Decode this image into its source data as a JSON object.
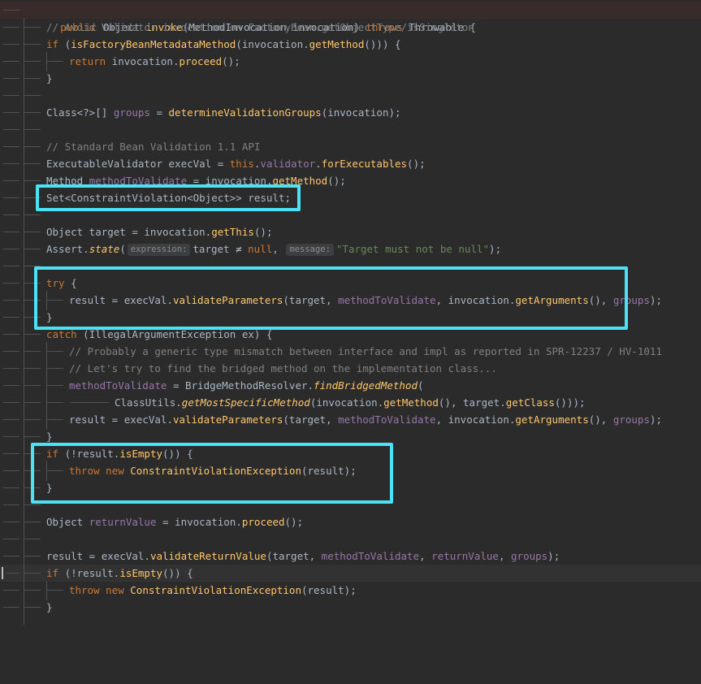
{
  "editor": {
    "lines": [
      {
        "text": "public Object invoke(MethodInvocation invocation) throws Throwable {"
      },
      {
        "text": "// Avoid Validator invocation on FactoryBean.getObjectType/isSingleton"
      },
      {
        "text": "if (isFactoryBeanMetadataMethod(invocation.getMethod())) {"
      },
      {
        "text": "return invocation.proceed();"
      },
      {
        "text": "}"
      },
      {
        "text": ""
      },
      {
        "text": "Class<?>[] groups = determineValidationGroups(invocation);"
      },
      {
        "text": ""
      },
      {
        "text": "// Standard Bean Validation 1.1 API"
      },
      {
        "text": "ExecutableValidator execVal = this.validator.forExecutables();"
      },
      {
        "text": "Method methodToValidate = invocation.getMethod();"
      },
      {
        "text": "Set<ConstraintViolation<Object>> result;"
      },
      {
        "text": ""
      },
      {
        "text": "Object target = invocation.getThis();"
      },
      {
        "text": "Assert.state( expression: target ≠ null,  message: \"Target must not be null\");"
      },
      {
        "text": ""
      },
      {
        "text": "try {"
      },
      {
        "text": "result = execVal.validateParameters(target, methodToValidate, invocation.getArguments(), groups);"
      },
      {
        "text": "}"
      },
      {
        "text": "catch (IllegalArgumentException ex) {"
      },
      {
        "text": "// Probably a generic type mismatch between interface and impl as reported in SPR-12237 / HV-1011"
      },
      {
        "text": "// Let's try to find the bridged method on the implementation class..."
      },
      {
        "text": "methodToValidate = BridgeMethodResolver.findBridgedMethod("
      },
      {
        "text": "ClassUtils.getMostSpecificMethod(invocation.getMethod(), target.getClass()));"
      },
      {
        "text": "result = execVal.validateParameters(target, methodToValidate, invocation.getArguments(), groups);"
      },
      {
        "text": "}"
      },
      {
        "text": "if (!result.isEmpty()) {"
      },
      {
        "text": "throw new ConstraintViolationException(result);"
      },
      {
        "text": "}"
      },
      {
        "text": ""
      },
      {
        "text": "Object returnValue = invocation.proceed();"
      },
      {
        "text": ""
      },
      {
        "text": "result = execVal.validateReturnValue(target, methodToValidate, returnValue, groups);"
      },
      {
        "text": "if (!result.isEmpty()) {"
      },
      {
        "text": "throw new ConstraintViolationException(result);"
      },
      {
        "text": "}"
      }
    ],
    "hints": {
      "expression": "expression:",
      "message": "message:"
    },
    "colors": {
      "keyword": "#cc7832",
      "method": "#ffc66d",
      "comment": "#808080",
      "string": "#6a8759",
      "field": "#9876aa",
      "default": "#a9b7c6",
      "background": "#2b2b2b",
      "callout": "#4ce1f5"
    }
  }
}
